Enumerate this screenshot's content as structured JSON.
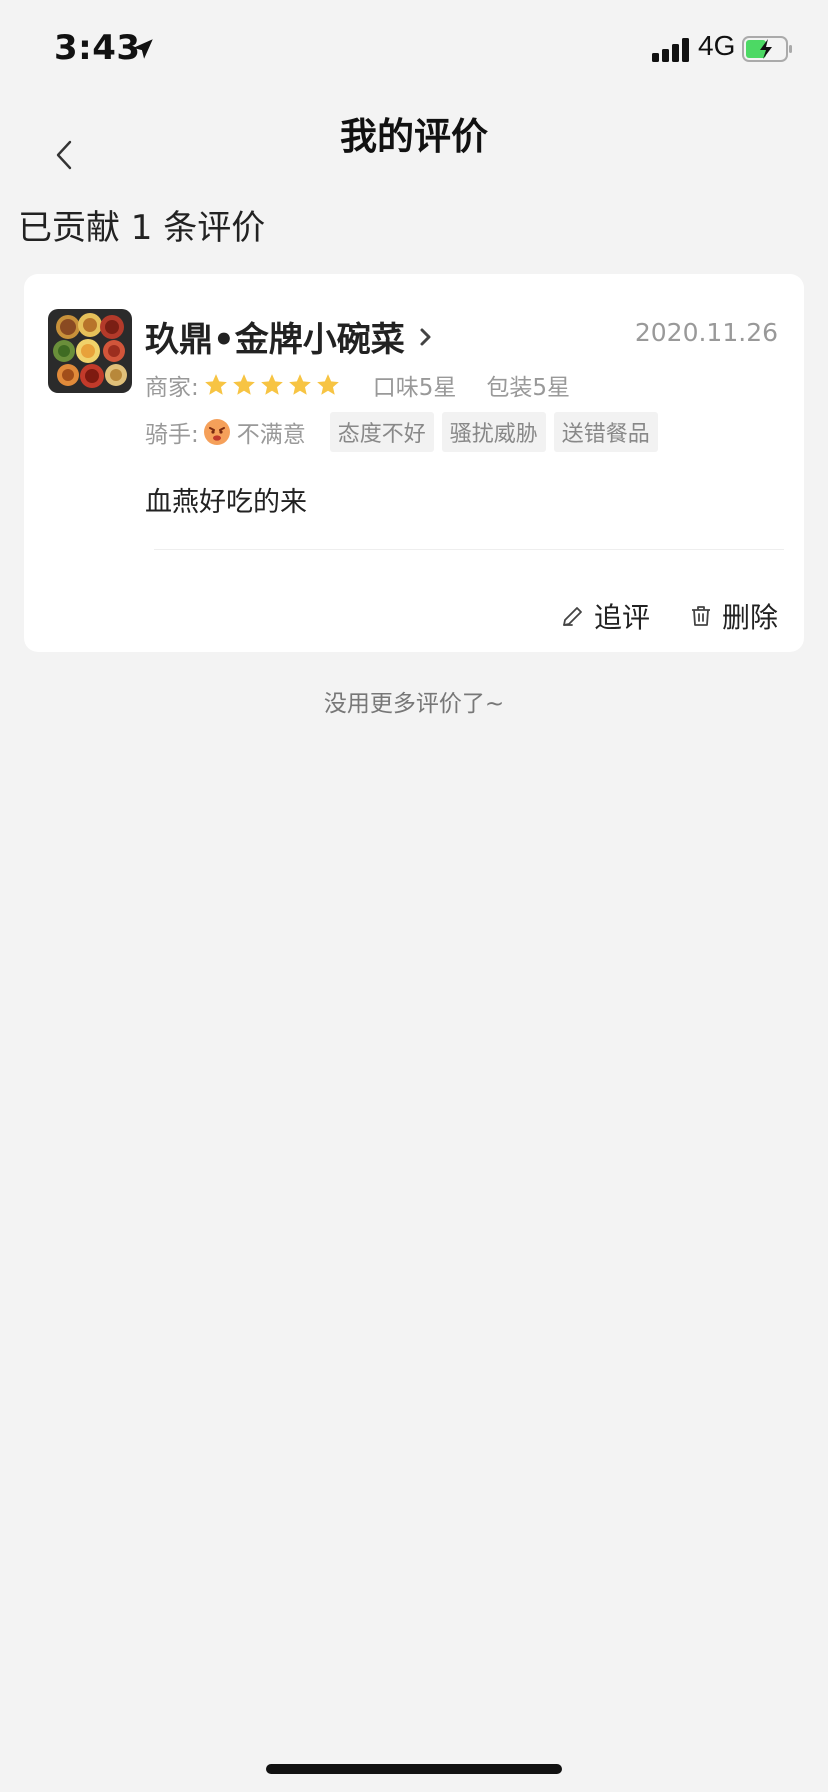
{
  "status_bar": {
    "time": "3:43",
    "network": "4G",
    "icons": [
      "location-arrow-icon",
      "signal-icon",
      "battery-charging-icon"
    ]
  },
  "nav": {
    "title": "我的评价",
    "back_icon": "chevron-left-icon"
  },
  "summary": {
    "text": "已贡献 1 条评价"
  },
  "review": {
    "store_name": "玖鼎•金牌小碗菜",
    "date": "2020.11.26",
    "merchant_label": "商家:",
    "merchant_stars": 5,
    "taste": "口味5星",
    "packaging": "包装5星",
    "rider_label": "骑手:",
    "rider_rating": "不满意",
    "rider_tags": [
      "态度不好",
      "骚扰威胁",
      "送错餐品"
    ],
    "comment": "血燕好吃的来",
    "actions": {
      "follow_up": "追评",
      "delete": "删除"
    }
  },
  "footer": {
    "no_more": "没用更多评价了~"
  },
  "colors": {
    "background": "#f3f3f3",
    "card": "#ffffff",
    "star": "#f7c443",
    "muted": "#999999"
  }
}
